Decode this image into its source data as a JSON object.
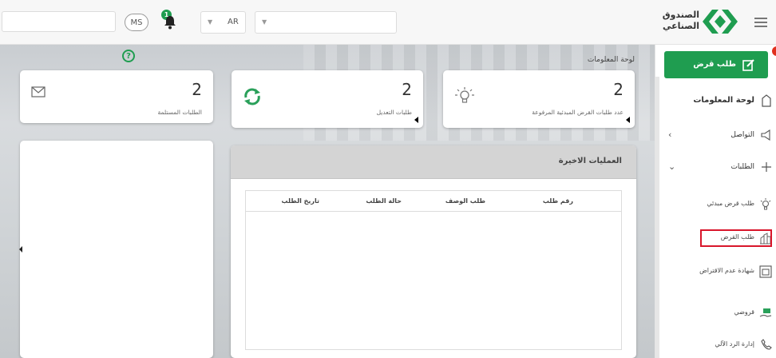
{
  "topbar": {
    "user_initials": "MS",
    "notification_count": "1",
    "language": "AR"
  },
  "logo": {
    "line1": "الصندوق",
    "line2": "الصناعي"
  },
  "breadcrumb": "لوحة المعلومات",
  "stats": [
    {
      "value": "2",
      "label": "عدد طلبات القرض المبدئية المرفوعة"
    },
    {
      "value": "2",
      "label": "طلبات التعديل"
    },
    {
      "value": "2",
      "label": "الطلبات المستلمة"
    }
  ],
  "recent_ops": {
    "title": "العمليات الاخيرة",
    "columns": [
      "رقم طلب",
      "طلب الوصف",
      "حالة الطلب",
      "تاريخ الطلب"
    ]
  },
  "sidebar": {
    "new_loan": "طلب قرض",
    "items": [
      {
        "label": "لوحة المعلومات"
      },
      {
        "label": "التواصل"
      },
      {
        "label": "الطلبات"
      },
      {
        "label": "طلب قرض مبدئي"
      },
      {
        "label": "طلب القرض"
      },
      {
        "label": "شهادة عدم الاقتراض"
      },
      {
        "label": "قروضي"
      },
      {
        "label": "إدارة الرد الآلي"
      }
    ]
  },
  "colors": {
    "brand_green": "#1f9d50",
    "alert_red": "#e0301e",
    "highlight_red": "#d9162b"
  }
}
